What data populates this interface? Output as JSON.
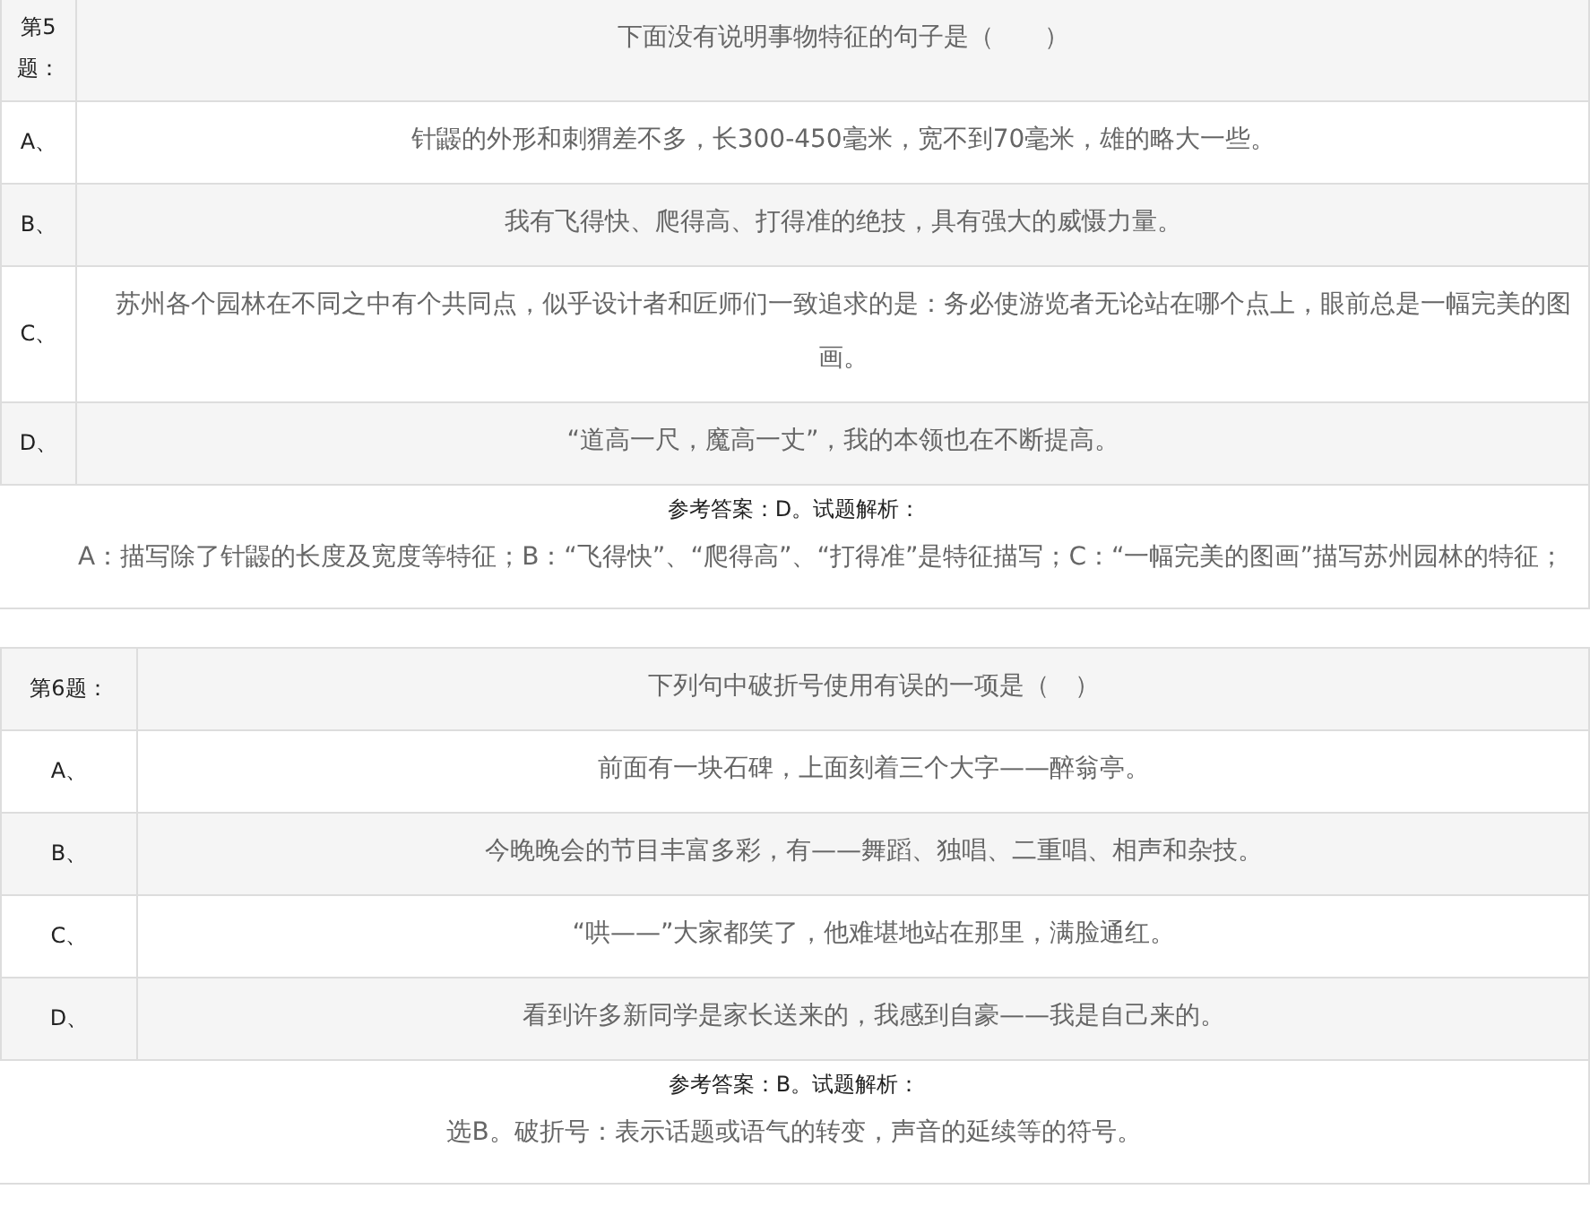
{
  "questions": [
    {
      "number": "第5题：",
      "stem": "下面没有说明事物特征的句子是（　　）",
      "options": [
        {
          "letter": "A、",
          "text": "针鼹的外形和刺猬差不多，长300-450毫米，宽不到70毫米，雄的略大一些。"
        },
        {
          "letter": "B、",
          "text": "我有飞得快、爬得高、打得准的绝技，具有强大的威慑力量。"
        },
        {
          "letter": "C、",
          "text": "苏州各个园林在不同之中有个共同点，似乎设计者和匠师们一致追求的是：务必使游览者无论站在哪个点上，眼前总是一幅完美的图画。"
        },
        {
          "letter": "D、",
          "text": "“道高一尺，魔高一丈”，我的本领也在不断提高。"
        }
      ],
      "answer_heading": "参考答案：D。试题解析：",
      "explanation": "A：描写除了针鼹的长度及宽度等特征；B：“飞得快”、“爬得高”、“打得准”是特征描写；C：“一幅完美的图画”描写苏州园林的特征；"
    },
    {
      "number": "第6题：",
      "stem": "下列句中破折号使用有误的一项是（　）",
      "options": [
        {
          "letter": "A、",
          "text": "前面有一块石碑，上面刻着三个大字——醉翁亭。"
        },
        {
          "letter": "B、",
          "text": "今晚晚会的节目丰富多彩，有——舞蹈、独唱、二重唱、相声和杂技。"
        },
        {
          "letter": "C、",
          "text": "“哄——”大家都笑了，他难堪地站在那里，满脸通红。"
        },
        {
          "letter": "D、",
          "text": "看到许多新同学是家长送来的，我感到自豪——我是自己来的。"
        }
      ],
      "answer_heading": "参考答案：B。试题解析：",
      "explanation": "选B。破折号：表示话题或语气的转变，声音的延续等的符号。"
    }
  ]
}
